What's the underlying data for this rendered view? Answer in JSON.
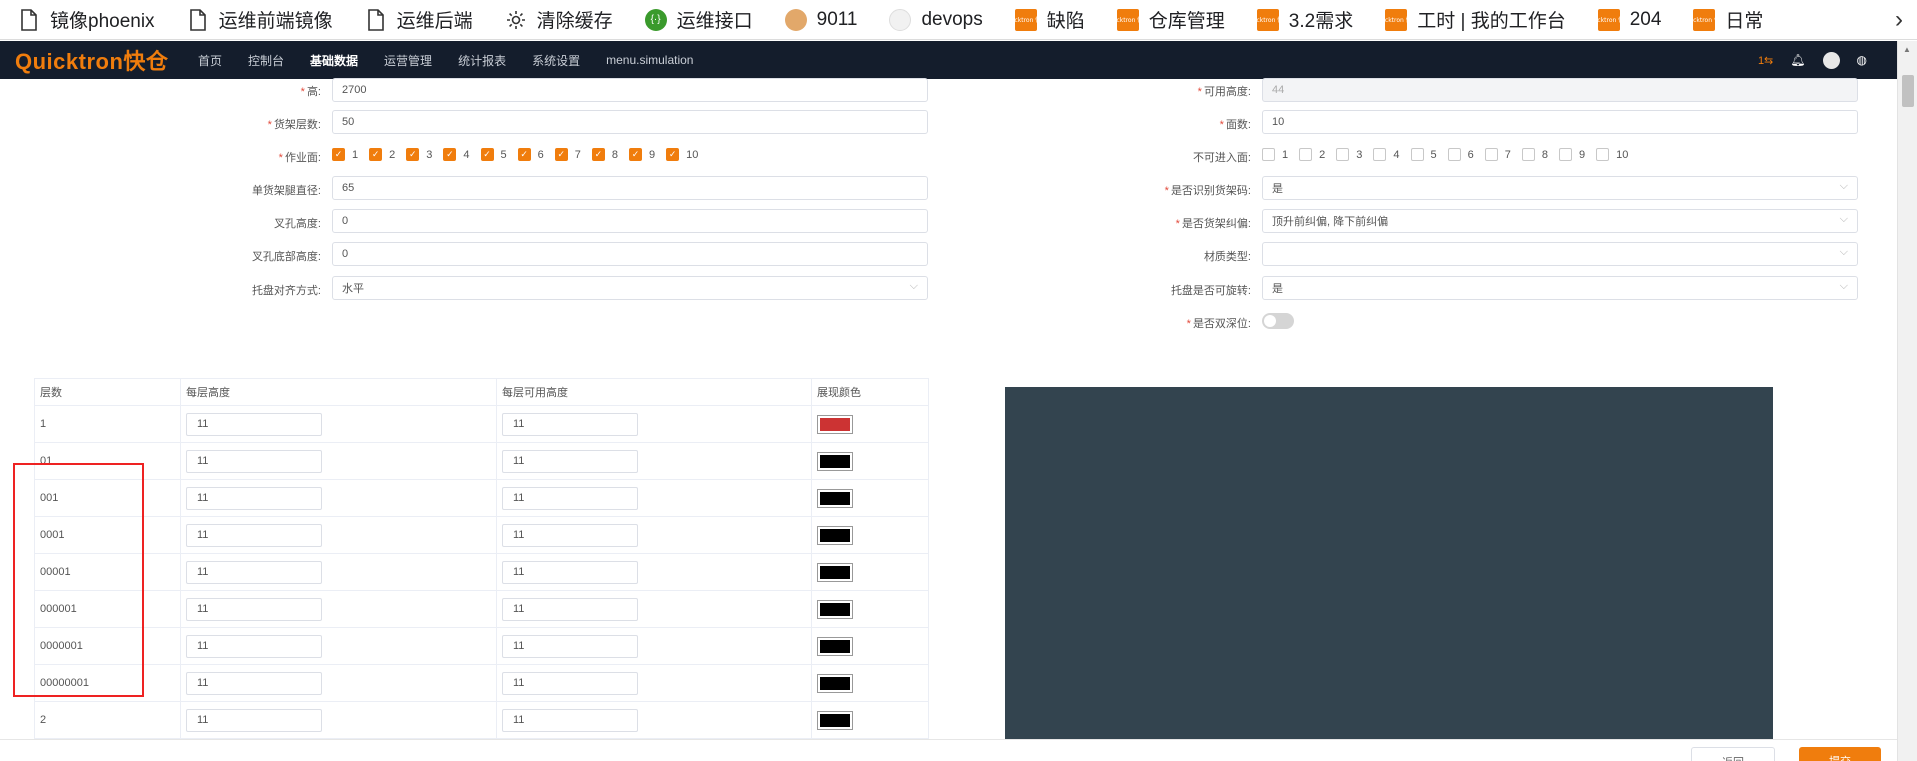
{
  "bookmarks": {
    "items": [
      {
        "label": "镜像phoenix",
        "icon": "file-icon"
      },
      {
        "label": "运维前端镜像",
        "icon": "file-icon"
      },
      {
        "label": "运维后端",
        "icon": "file-icon"
      },
      {
        "label": "清除缓存",
        "icon": "gear-icon"
      },
      {
        "label": "运维接口",
        "icon": "api-icon"
      },
      {
        "label": "9011",
        "icon": "site-icon"
      },
      {
        "label": "devops",
        "icon": "site-icon"
      },
      {
        "label": "缺陷",
        "icon": "quicktron-icon"
      },
      {
        "label": "仓库管理",
        "icon": "quicktron-icon"
      },
      {
        "label": "3.2需求",
        "icon": "quicktron-icon"
      },
      {
        "label": "工时 | 我的工作台",
        "icon": "quicktron-icon"
      },
      {
        "label": "204",
        "icon": "quicktron-icon"
      },
      {
        "label": "日常",
        "icon": "quicktron-icon"
      }
    ],
    "favicon_text": "Quicktron 快仓"
  },
  "app": {
    "logo": "Quicktron快仓",
    "nav": [
      "首页",
      "控制台",
      "基础数据",
      "运营管理",
      "统计报表",
      "系统设置",
      "menu.simulation"
    ],
    "active_nav": "基础数据",
    "task_count": "1⇆"
  },
  "form": {
    "height_label": "高:",
    "height_value": "2700",
    "available_height_label": "可用高度:",
    "available_height_value": "44",
    "shelf_layers_label": "货架层数:",
    "shelf_layers_value": "50",
    "faces_label": "面数:",
    "faces_value": "10",
    "work_face_label": "作业面:",
    "work_face_options": [
      "1",
      "2",
      "3",
      "4",
      "5",
      "6",
      "7",
      "8",
      "9",
      "10"
    ],
    "work_face_checked": true,
    "no_entry_face_label": "不可进入面:",
    "no_entry_face_options": [
      "1",
      "2",
      "3",
      "4",
      "5",
      "6",
      "7",
      "8",
      "9",
      "10"
    ],
    "no_entry_face_checked": false,
    "leg_diameter_label": "单货架腿直径:",
    "leg_diameter_value": "65",
    "identify_shelf_code_label": "是否识别货架码:",
    "identify_shelf_code_value": "是",
    "fork_height_label": "叉孔高度:",
    "fork_height_value": "0",
    "shelf_correction_label": "是否货架纠偏:",
    "shelf_correction_value": "顶升前纠偏, 降下前纠偏",
    "fork_bottom_height_label": "叉孔底部高度:",
    "fork_bottom_height_value": "0",
    "material_type_label": "材质类型:",
    "material_type_value": "",
    "tray_align_label": "托盘对齐方式:",
    "tray_align_value": "水平",
    "tray_rotatable_label": "托盘是否可旋转:",
    "tray_rotatable_value": "是",
    "double_deep_label": "是否双深位:",
    "double_deep_on": false
  },
  "table": {
    "headers": [
      "层数",
      "每层高度",
      "每层可用高度",
      "展现颜色"
    ],
    "rows": [
      {
        "layer": "1",
        "height": "11",
        "available": "11",
        "color": "#cc3333"
      },
      {
        "layer": "01",
        "height": "11",
        "available": "11",
        "color": "#000000"
      },
      {
        "layer": "001",
        "height": "11",
        "available": "11",
        "color": "#000000"
      },
      {
        "layer": "0001",
        "height": "11",
        "available": "11",
        "color": "#000000"
      },
      {
        "layer": "00001",
        "height": "11",
        "available": "11",
        "color": "#000000"
      },
      {
        "layer": "000001",
        "height": "11",
        "available": "11",
        "color": "#000000"
      },
      {
        "layer": "0000001",
        "height": "11",
        "available": "11",
        "color": "#000000"
      },
      {
        "layer": "00000001",
        "height": "11",
        "available": "11",
        "color": "#000000"
      },
      {
        "layer": "2",
        "height": "11",
        "available": "11",
        "color": "#000000"
      }
    ]
  },
  "footer": {
    "back_label": "返回",
    "submit_label": "提交"
  },
  "colors": {
    "accent": "#f07d0d",
    "nav_bg": "#141d2c",
    "preview_bg": "#33444f",
    "required": "#e24a3b",
    "highlight": "#ee2222"
  }
}
